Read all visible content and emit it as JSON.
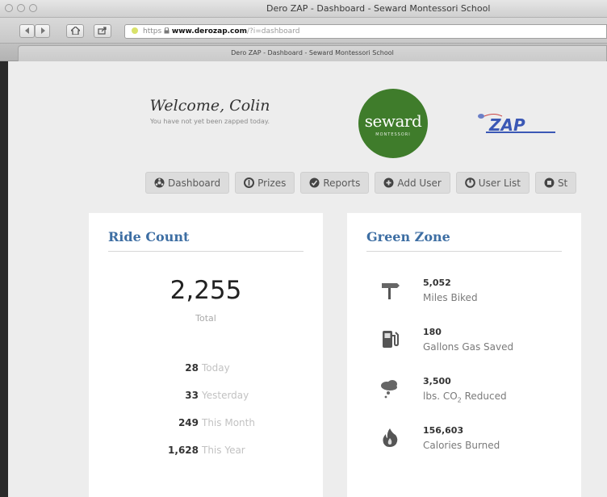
{
  "window": {
    "title": "Dero ZAP - Dashboard - Seward Montessori School",
    "tab_title": "Dero ZAP - Dashboard - Seward Montessori School"
  },
  "address_bar": {
    "prefix": "https",
    "host": "www.derozap.com",
    "path": "/?i=dashboard"
  },
  "header": {
    "welcome": "Welcome, Colin",
    "subtitle": "You have not yet been zapped today.",
    "school_logo_text": "seward",
    "school_logo_subtext": "MONTESSORI",
    "zap_logo_text": "ZAP"
  },
  "nav": {
    "items": [
      {
        "label": "Dashboard",
        "icon": "dashboard-icon"
      },
      {
        "label": "Prizes",
        "icon": "prize-icon"
      },
      {
        "label": "Reports",
        "icon": "reports-icon"
      },
      {
        "label": "Add User",
        "icon": "add-icon"
      },
      {
        "label": "User List",
        "icon": "user-list-icon"
      },
      {
        "label": "St",
        "icon": "settings-icon"
      }
    ]
  },
  "ride_count": {
    "title": "Ride Count",
    "total": "2,255",
    "total_label": "Total",
    "stats": [
      {
        "value": "28",
        "label": "Today"
      },
      {
        "value": "33",
        "label": "Yesterday"
      },
      {
        "value": "249",
        "label": "This Month"
      },
      {
        "value": "1,628",
        "label": "This Year"
      }
    ]
  },
  "green_zone": {
    "title": "Green Zone",
    "items": [
      {
        "value": "5,052",
        "label": "Miles Biked",
        "icon": "signpost-icon"
      },
      {
        "value": "180",
        "label": "Gallons Gas Saved",
        "icon": "gas-pump-icon"
      },
      {
        "value": "3,500",
        "label_pre": "lbs. CO",
        "label_sub": "2",
        "label_post": " Reduced",
        "icon": "cloud-icon"
      },
      {
        "value": "156,603",
        "label": "Calories Burned",
        "icon": "flame-icon"
      }
    ]
  },
  "colors": {
    "accent_blue": "#3d6ea3",
    "seward_green": "#3f7c2b",
    "page_bg": "#ededed"
  }
}
